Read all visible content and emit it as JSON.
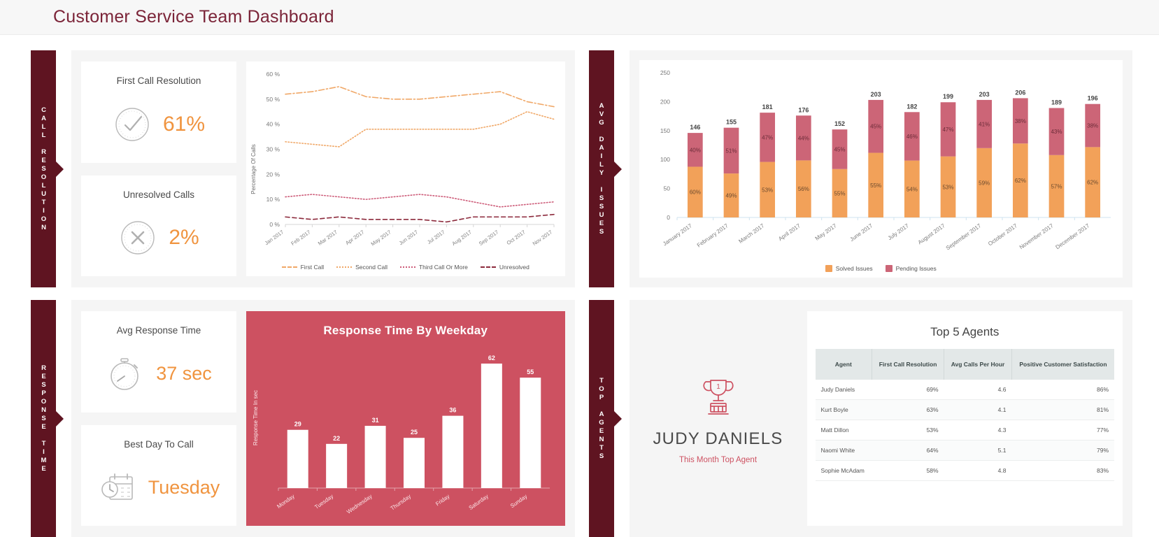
{
  "header": {
    "title": "Customer Service Team Dashboard"
  },
  "colors": {
    "accent_orange": "#f0943f",
    "maroon": "#5f1421",
    "title_maroon": "#7b2438",
    "red_card": "#cd5161",
    "solved": "#f2a159",
    "pending": "#cc6577"
  },
  "sections": {
    "call_resolution": {
      "label": "CALL RESOLUTION"
    },
    "avg_daily_issues": {
      "label": "AVG DAILY ISSUES"
    },
    "response_time": {
      "label": "RESPONSE TIME"
    },
    "top_agents": {
      "label": "TOP AGENTS"
    }
  },
  "kpis": {
    "first_call_resolution": {
      "title": "First Call Resolution",
      "value": "61%",
      "icon": "check-circle-icon"
    },
    "unresolved_calls": {
      "title": "Unresolved Calls",
      "value": "2%",
      "icon": "x-circle-icon"
    },
    "avg_response_time": {
      "title": "Avg Response Time",
      "value": "37 sec",
      "icon": "stopwatch-icon"
    },
    "best_day_to_call": {
      "title": "Best Day To Call",
      "value": "Tuesday",
      "icon": "calendar-clock-icon"
    }
  },
  "top_agent": {
    "name": "JUDY DANIELS",
    "subtitle": "This Month Top Agent",
    "icon": "trophy-icon"
  },
  "agents_table": {
    "title": "Top 5 Agents",
    "columns": [
      "Agent",
      "First Call Resolution",
      "Avg Calls Per Hour",
      "Positive Customer Satisfaction"
    ],
    "rows": [
      {
        "agent": "Judy Daniels",
        "fcr": "69%",
        "calls": "4.6",
        "satisfaction": "86%"
      },
      {
        "agent": "Kurt Boyle",
        "fcr": "63%",
        "calls": "4.1",
        "satisfaction": "81%"
      },
      {
        "agent": "Matt Dillon",
        "fcr": "53%",
        "calls": "4.3",
        "satisfaction": "77%"
      },
      {
        "agent": "Naomi White",
        "fcr": "64%",
        "calls": "5.1",
        "satisfaction": "79%"
      },
      {
        "agent": "Sophie McAdam",
        "fcr": "58%",
        "calls": "4.8",
        "satisfaction": "83%"
      }
    ]
  },
  "chart_data": [
    {
      "id": "call_resolution_lines",
      "type": "line",
      "title": "",
      "xlabel": "",
      "ylabel": "Percentage Of Calls",
      "ylim": [
        0,
        60
      ],
      "yticks": [
        "0 %",
        "10 %",
        "20 %",
        "30 %",
        "40 %",
        "50 %",
        "60 %"
      ],
      "categories": [
        "Jan 2017",
        "Feb 2017",
        "Mar 2017",
        "Apr 2017",
        "May 2017",
        "Jun 2017",
        "Jul 2017",
        "Aug 2017",
        "Sep 2017",
        "Oct 2017",
        "Nov 2017"
      ],
      "legend_position": "bottom",
      "grid": false,
      "series": [
        {
          "name": "First Call",
          "color": "#f0a868",
          "dash": "dashdot",
          "values": [
            52,
            53,
            55,
            51,
            50,
            50,
            51,
            52,
            53,
            49,
            47
          ]
        },
        {
          "name": "Second Call",
          "color": "#f0a868",
          "dash": "dotted",
          "values": [
            33,
            32,
            31,
            38,
            38,
            38,
            38,
            38,
            40,
            45,
            42
          ]
        },
        {
          "name": "Third Call Or More",
          "color": "#cd5c79",
          "dash": "dotted",
          "values": [
            11,
            12,
            11,
            10,
            11,
            12,
            11,
            9,
            7,
            8,
            9
          ]
        },
        {
          "name": "Unresolved",
          "color": "#8c2a3c",
          "dash": "dashed",
          "values": [
            3,
            2,
            3,
            2,
            2,
            2,
            1,
            3,
            3,
            3,
            4
          ]
        }
      ]
    },
    {
      "id": "avg_daily_issues_bars",
      "type": "bar",
      "stacked": true,
      "title": "",
      "xlabel": "",
      "ylabel": "",
      "ylim": [
        0,
        250
      ],
      "yticks": [
        "0",
        "50",
        "100",
        "150",
        "200",
        "250"
      ],
      "categories": [
        "January 2017",
        "February 2017",
        "March 2017",
        "April 2017",
        "May 2017",
        "June 2017",
        "July 2017",
        "August 2017",
        "September 2017",
        "October 2017",
        "November 2017",
        "December 2017"
      ],
      "totals": [
        146,
        155,
        181,
        176,
        152,
        203,
        182,
        199,
        203,
        206,
        189,
        196
      ],
      "legend_position": "bottom",
      "series": [
        {
          "name": "Solved Issues",
          "color": "#f2a159",
          "percent_labels": [
            "60%",
            "49%",
            "53%",
            "56%",
            "55%",
            "55%",
            "54%",
            "53%",
            "59%",
            "62%",
            "57%",
            "62%"
          ]
        },
        {
          "name": "Pending Issues",
          "color": "#cc6577",
          "percent_labels": [
            "40%",
            "51%",
            "47%",
            "44%",
            "45%",
            "45%",
            "46%",
            "47%",
            "41%",
            "38%",
            "43%",
            "38%"
          ]
        }
      ]
    },
    {
      "id": "response_time_by_weekday",
      "type": "bar",
      "title": "Response Time By Weekday",
      "xlabel": "",
      "ylabel": "Response Time In sec",
      "ylim": [
        0,
        70
      ],
      "categories": [
        "Monday",
        "Tuesday",
        "Wednesday",
        "Thursday",
        "Friday",
        "Saturday",
        "Sunday"
      ],
      "values": [
        29,
        22,
        31,
        25,
        36,
        62,
        55
      ],
      "grid": false,
      "legend_position": "none",
      "bar_color": "#ffffff",
      "background": "#cd5161"
    }
  ]
}
